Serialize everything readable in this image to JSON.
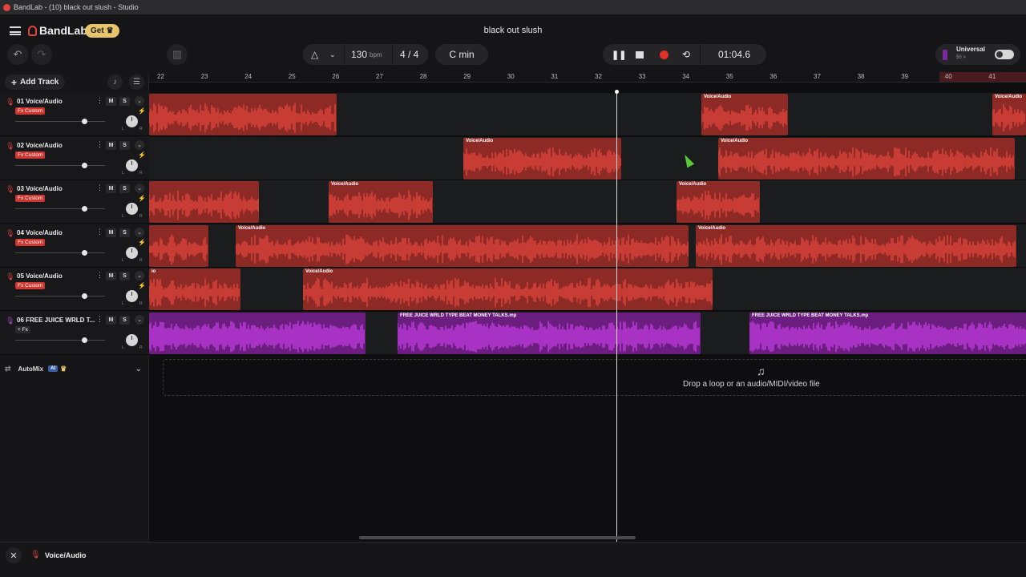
{
  "window": {
    "title": "BandLab - (10) black out slush - Studio"
  },
  "header": {
    "brand": "BandLab",
    "get_label": "Get",
    "song_title": "black out slush",
    "bpm_value": "130",
    "bpm_unit": "bpm",
    "time_signature": "4 / 4",
    "key": "C min",
    "time_display": "01:04.6",
    "universal_label": "Universal",
    "universal_sub": "50 >"
  },
  "toolbar": {
    "add_track_label": "Add Track"
  },
  "ruler": {
    "bars": [
      "22",
      "23",
      "24",
      "25",
      "26",
      "27",
      "28",
      "29",
      "30",
      "31",
      "32",
      "33",
      "34",
      "35",
      "36",
      "37",
      "38",
      "39",
      "40",
      "41"
    ]
  },
  "tracks": [
    {
      "name": "01  Voice/Audio",
      "fx": "Fx Custom",
      "type": "audio"
    },
    {
      "name": "02  Voice/Audio",
      "fx": "Fx Custom",
      "type": "audio"
    },
    {
      "name": "03  Voice/Audio",
      "fx": "Fx Custom",
      "type": "audio"
    },
    {
      "name": "04  Voice/Audio",
      "fx": "Fx Custom",
      "type": "audio"
    },
    {
      "name": "05  Voice/Audio",
      "fx": "Fx Custom",
      "type": "audio"
    },
    {
      "name": "06  FREE JUICE WRLD T...",
      "fx": "+ Fx",
      "type": "loop"
    }
  ],
  "track_controls": {
    "mute": "M",
    "solo": "S",
    "left": "L",
    "right": "R"
  },
  "clips": {
    "voice_label": "Voice/Audio",
    "voice_label_cut": "io",
    "beat_label": "FREE JUICE WRLD TYPE BEAT MONEY TALKS.mp"
  },
  "automix": {
    "label": "AutoMix",
    "badge": "AI"
  },
  "dropzone": {
    "text": "Drop a loop or an audio/MIDI/video file"
  },
  "footer": {
    "track_label": "Voice/Audio"
  },
  "colors": {
    "accent_red": "#e0443a",
    "clip_red": "#8e2a26",
    "clip_purple": "#6b1e80",
    "get_gold": "#e8c46a"
  }
}
